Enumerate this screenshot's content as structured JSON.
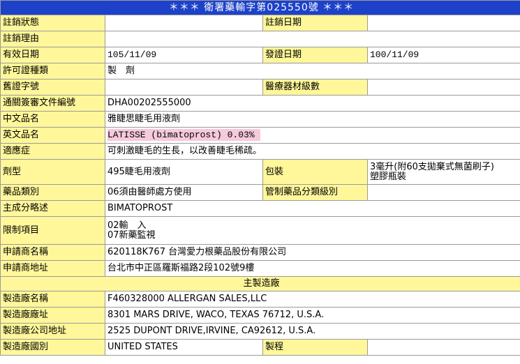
{
  "title": "＊＊＊ 衛署藥輸字第025550號 ＊＊＊",
  "rows": {
    "cancel_status": {
      "label": "註銷狀態",
      "value": ""
    },
    "cancel_date": {
      "label": "註銷日期",
      "value": ""
    },
    "cancel_reason": {
      "label": "註銷理由",
      "value": ""
    },
    "valid_date": {
      "label": "有效日期",
      "value": "105/11/09"
    },
    "issue_date": {
      "label": "發證日期",
      "value": "100/11/09"
    },
    "license_type": {
      "label": "許可證種類",
      "value": "製　劑"
    },
    "old_license_no": {
      "label": "舊證字號",
      "value": ""
    },
    "device_class": {
      "label": "醫療器材級數",
      "value": ""
    },
    "customs_doc_no": {
      "label": "通關簽審文件編號",
      "value": "DHA00202555000"
    },
    "chinese_name": {
      "label": "中文品名",
      "value": "雅睫思睫毛用液劑"
    },
    "english_name": {
      "label": "英文品名",
      "value": "LATISSE (bimatoprost) 0.03%"
    },
    "indication": {
      "label": "適應症",
      "value": "可刺激睫毛的生長，以改善睫毛稀疏。"
    },
    "dosage_form": {
      "label": "劑型",
      "value": "495睫毛用液劑"
    },
    "packaging": {
      "label": "包裝",
      "value_line1": "3毫升(附60支拋棄式無菌刷子)",
      "value_line2": "塑膠瓶裝"
    },
    "drug_category": {
      "label": "藥品類別",
      "value": "06須由醫師處方使用"
    },
    "controlled_class": {
      "label": "管制藥品分類級別",
      "value": ""
    },
    "ingredient": {
      "label": "主成分略述",
      "value": "BIMATOPROST"
    },
    "restrictions": {
      "label": "限制項目",
      "value_line1": "02輸　入",
      "value_line2": "07新藥監視"
    },
    "applicant_name": {
      "label": "申請商名稱",
      "value": "620118K767 台灣愛力根藥品股份有限公司"
    },
    "applicant_address": {
      "label": "申請商地址",
      "value": "台北市中正區羅斯福路2段102號9樓"
    },
    "manufacturer_section": {
      "label": "主製造廠"
    },
    "mfr_name": {
      "label": "製造廠名稱",
      "value": "F460328000 ALLERGAN SALES,LLC"
    },
    "mfr_address": {
      "label": "製造廠廠址",
      "value": "8301 MARS DRIVE, WACO, TEXAS 76712, U.S.A."
    },
    "mfr_company_address": {
      "label": "製造廠公司地址",
      "value": "2525 DUPONT DRIVE,IRVINE, CA92612, U.S.A."
    },
    "mfr_country": {
      "label": "製造廠國別",
      "value": "UNITED STATES"
    },
    "process": {
      "label": "製程",
      "value": ""
    }
  },
  "colors": {
    "title_bg": "#1d41c9",
    "label_bg": "#fff79a",
    "highlight": "#f7c9dc",
    "border": "#9a9a9a"
  }
}
